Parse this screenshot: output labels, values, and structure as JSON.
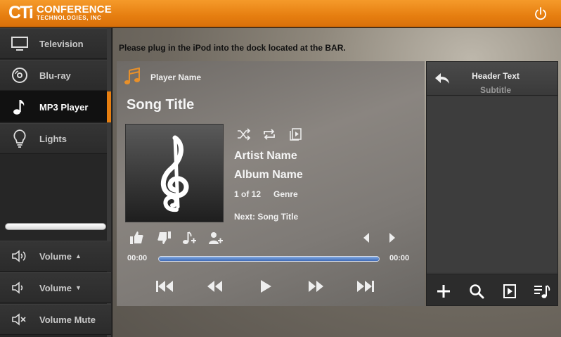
{
  "header": {
    "logo_mark": "CTi",
    "logo_line1": "CONFERENCE",
    "logo_line2": "TECHNOLOGIES, INC"
  },
  "sidebar": {
    "items": [
      {
        "label": "Television",
        "icon": "monitor-icon"
      },
      {
        "label": "Blu-ray",
        "icon": "disc-icon"
      },
      {
        "label": "MP3 Player",
        "icon": "music-note-icon",
        "active": true
      },
      {
        "label": "Lights",
        "icon": "lightbulb-icon"
      }
    ],
    "volume_level": 1.0,
    "volume_items": [
      {
        "label": "Volume",
        "arrow": "▲",
        "icon": "volume-up-icon"
      },
      {
        "label": "Volume",
        "arrow": "▼",
        "icon": "volume-down-icon"
      },
      {
        "label": "Volume Mute",
        "icon": "volume-mute-icon"
      }
    ]
  },
  "main": {
    "notice": "Please plug in the iPod into the dock located at the BAR."
  },
  "player": {
    "player_name": "Player Name",
    "song_title": "Song Title",
    "artist": "Artist Name",
    "album": "Album Name",
    "track_count": "1 of 12",
    "genre": "Genre",
    "next_song": "Next: Song Title",
    "time_elapsed": "00:00",
    "time_total": "00:00",
    "progress": 1.0
  },
  "side_panel": {
    "header_text": "Header Text",
    "subtitle": "Subtitle"
  },
  "colors": {
    "accent": "#e67e10",
    "progress": "#3e6ab7"
  }
}
